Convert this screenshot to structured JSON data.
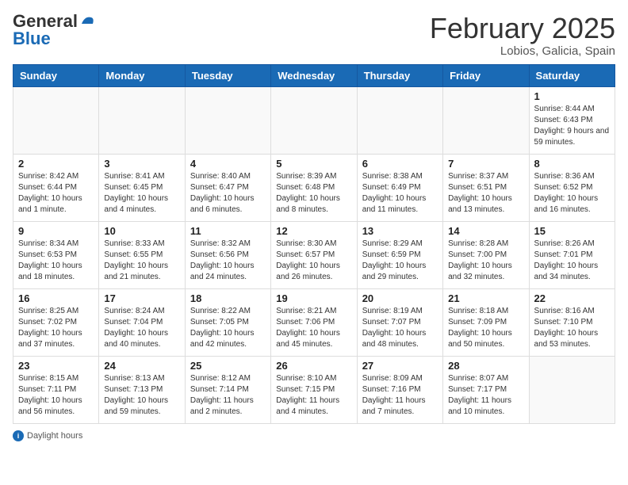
{
  "header": {
    "logo_general": "General",
    "logo_blue": "Blue",
    "month_title": "February 2025",
    "location": "Lobios, Galicia, Spain"
  },
  "weekdays": [
    "Sunday",
    "Monday",
    "Tuesday",
    "Wednesday",
    "Thursday",
    "Friday",
    "Saturday"
  ],
  "weeks": [
    [
      {
        "day": "",
        "info": ""
      },
      {
        "day": "",
        "info": ""
      },
      {
        "day": "",
        "info": ""
      },
      {
        "day": "",
        "info": ""
      },
      {
        "day": "",
        "info": ""
      },
      {
        "day": "",
        "info": ""
      },
      {
        "day": "1",
        "info": "Sunrise: 8:44 AM\nSunset: 6:43 PM\nDaylight: 9 hours and 59 minutes."
      }
    ],
    [
      {
        "day": "2",
        "info": "Sunrise: 8:42 AM\nSunset: 6:44 PM\nDaylight: 10 hours and 1 minute."
      },
      {
        "day": "3",
        "info": "Sunrise: 8:41 AM\nSunset: 6:45 PM\nDaylight: 10 hours and 4 minutes."
      },
      {
        "day": "4",
        "info": "Sunrise: 8:40 AM\nSunset: 6:47 PM\nDaylight: 10 hours and 6 minutes."
      },
      {
        "day": "5",
        "info": "Sunrise: 8:39 AM\nSunset: 6:48 PM\nDaylight: 10 hours and 8 minutes."
      },
      {
        "day": "6",
        "info": "Sunrise: 8:38 AM\nSunset: 6:49 PM\nDaylight: 10 hours and 11 minutes."
      },
      {
        "day": "7",
        "info": "Sunrise: 8:37 AM\nSunset: 6:51 PM\nDaylight: 10 hours and 13 minutes."
      },
      {
        "day": "8",
        "info": "Sunrise: 8:36 AM\nSunset: 6:52 PM\nDaylight: 10 hours and 16 minutes."
      }
    ],
    [
      {
        "day": "9",
        "info": "Sunrise: 8:34 AM\nSunset: 6:53 PM\nDaylight: 10 hours and 18 minutes."
      },
      {
        "day": "10",
        "info": "Sunrise: 8:33 AM\nSunset: 6:55 PM\nDaylight: 10 hours and 21 minutes."
      },
      {
        "day": "11",
        "info": "Sunrise: 8:32 AM\nSunset: 6:56 PM\nDaylight: 10 hours and 24 minutes."
      },
      {
        "day": "12",
        "info": "Sunrise: 8:30 AM\nSunset: 6:57 PM\nDaylight: 10 hours and 26 minutes."
      },
      {
        "day": "13",
        "info": "Sunrise: 8:29 AM\nSunset: 6:59 PM\nDaylight: 10 hours and 29 minutes."
      },
      {
        "day": "14",
        "info": "Sunrise: 8:28 AM\nSunset: 7:00 PM\nDaylight: 10 hours and 32 minutes."
      },
      {
        "day": "15",
        "info": "Sunrise: 8:26 AM\nSunset: 7:01 PM\nDaylight: 10 hours and 34 minutes."
      }
    ],
    [
      {
        "day": "16",
        "info": "Sunrise: 8:25 AM\nSunset: 7:02 PM\nDaylight: 10 hours and 37 minutes."
      },
      {
        "day": "17",
        "info": "Sunrise: 8:24 AM\nSunset: 7:04 PM\nDaylight: 10 hours and 40 minutes."
      },
      {
        "day": "18",
        "info": "Sunrise: 8:22 AM\nSunset: 7:05 PM\nDaylight: 10 hours and 42 minutes."
      },
      {
        "day": "19",
        "info": "Sunrise: 8:21 AM\nSunset: 7:06 PM\nDaylight: 10 hours and 45 minutes."
      },
      {
        "day": "20",
        "info": "Sunrise: 8:19 AM\nSunset: 7:07 PM\nDaylight: 10 hours and 48 minutes."
      },
      {
        "day": "21",
        "info": "Sunrise: 8:18 AM\nSunset: 7:09 PM\nDaylight: 10 hours and 50 minutes."
      },
      {
        "day": "22",
        "info": "Sunrise: 8:16 AM\nSunset: 7:10 PM\nDaylight: 10 hours and 53 minutes."
      }
    ],
    [
      {
        "day": "23",
        "info": "Sunrise: 8:15 AM\nSunset: 7:11 PM\nDaylight: 10 hours and 56 minutes."
      },
      {
        "day": "24",
        "info": "Sunrise: 8:13 AM\nSunset: 7:13 PM\nDaylight: 10 hours and 59 minutes."
      },
      {
        "day": "25",
        "info": "Sunrise: 8:12 AM\nSunset: 7:14 PM\nDaylight: 11 hours and 2 minutes."
      },
      {
        "day": "26",
        "info": "Sunrise: 8:10 AM\nSunset: 7:15 PM\nDaylight: 11 hours and 4 minutes."
      },
      {
        "day": "27",
        "info": "Sunrise: 8:09 AM\nSunset: 7:16 PM\nDaylight: 11 hours and 7 minutes."
      },
      {
        "day": "28",
        "info": "Sunrise: 8:07 AM\nSunset: 7:17 PM\nDaylight: 11 hours and 10 minutes."
      },
      {
        "day": "",
        "info": ""
      }
    ]
  ],
  "footer": {
    "icon": "i",
    "daylight_label": "Daylight hours"
  }
}
